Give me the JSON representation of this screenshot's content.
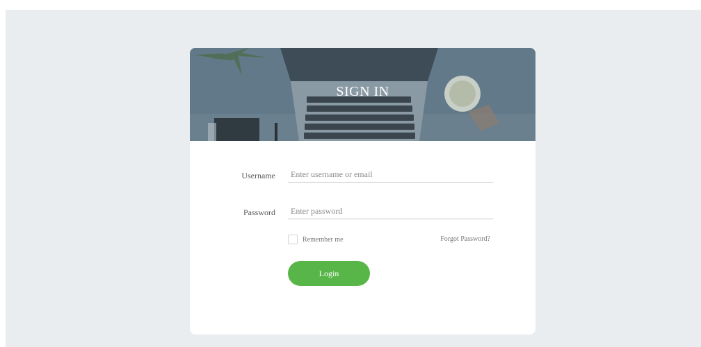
{
  "hero": {
    "title": "SIGN IN"
  },
  "form": {
    "username_label": "Username",
    "username_placeholder": "Enter username or email",
    "password_label": "Password",
    "password_placeholder": "Enter password",
    "remember_label": "Remember me",
    "forgot_label": "Forgot Password?",
    "login_label": "Login"
  },
  "colors": {
    "page_background": "#e9edef",
    "hero_overlay": "#5f7784",
    "login_button": "#58b547"
  }
}
